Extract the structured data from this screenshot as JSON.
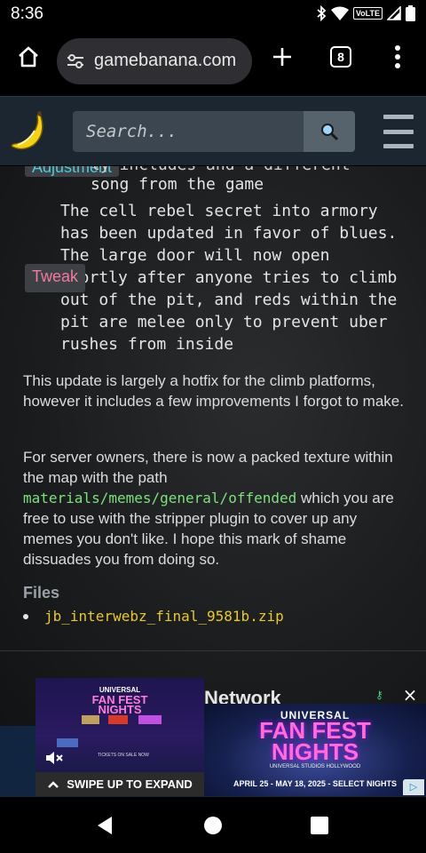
{
  "status": {
    "time": "8:36",
    "network_badge": "VoLTE"
  },
  "browser": {
    "url": "gamebanana.com",
    "tab_count": "8"
  },
  "site": {
    "search_placeholder": "Search..."
  },
  "content": {
    "adjustment_badge": "Adjustment",
    "prev_line_partial": "ly includes and a different",
    "prev_line_2": "song from the game",
    "tweak_badge": "Tweak",
    "tweak_text": "The cell rebel secret into armory has been updated in favor of blues. The large door will now open shortly after anyone tries to climb out of the pit, and reds within the pit are melee only to prevent uber rushes from inside",
    "para1": "This update is largely a hotfix for the climb platforms, however it includes a few improvements I forgot to make.",
    "para2_before": "For server owners, there is now a packed texture within the map with the path ",
    "para2_code": "materials/memes/general/offended",
    "para2_after": " which you are free to use with the stripper plugin to cover up any memes you don't like. I hope this mark of shame dissuades you from doing so.",
    "files_title": "Files",
    "files": [
      "jb_interwebz_final_9581b.zip"
    ],
    "network_heading": "Network"
  },
  "ad": {
    "brand_small": "UNIVERSAL",
    "title_line1": "FAN FEST",
    "title_line2": "NIGHTS",
    "location": "UNIVERSAL STUDIOS HOLLYWOOD",
    "dates": "APRIL 25 - MAY 18, 2025 - SELECT NIGHTS",
    "swipe_label": "SWIPE UP TO EXPAND",
    "tickets_label": "TICKETS ON SALE NOW",
    "close": "×"
  },
  "colors": {
    "header_bg": "#1b2630",
    "adjustment": "#4ec9d8",
    "tweak": "#f07aa0",
    "code_green": "#7ee07e",
    "file_link": "#e8c830"
  }
}
